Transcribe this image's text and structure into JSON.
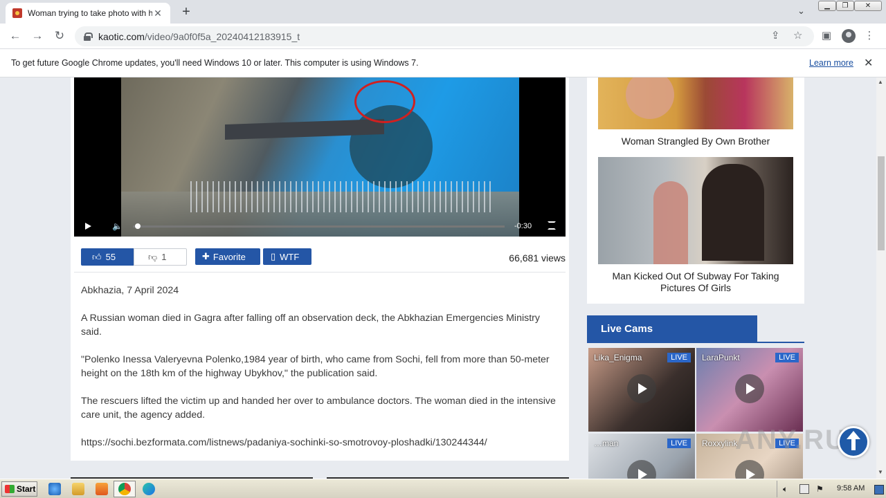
{
  "browser": {
    "tab_title": "Woman trying to take photo with he",
    "tab_close": "✕",
    "new_tab": "+",
    "url_host": "kaotic.com",
    "url_path": "/video/9a0f0f5a_20240412183915_t"
  },
  "infobar": {
    "message": "To get future Google Chrome updates, you'll need Windows 10 or later. This computer is using Windows 7.",
    "learn_more": "Learn more"
  },
  "video": {
    "time": "-0:30"
  },
  "actions": {
    "likes": "55",
    "dislikes": "1",
    "favorite_label": "Favorite",
    "wtf_label": "WTF",
    "views": "66,681 views"
  },
  "article": {
    "dateline": "Abkhazia, 7 April 2024",
    "p1": "A Russian woman died in Gagra after falling off an observation deck, the Abkhazian Emergencies Ministry said.",
    "p2": "\"Polenko Inessa Valeryevna Polenko,1984 year of birth, who came from Sochi, fell from more than 50-meter height on the 18th km of the highway Ubykhov,\" the publication said.",
    "p3": "The rescuers lifted the victim up and handed her over to ambulance doctors. The woman died in the intensive care unit, the agency added.",
    "source": "https://sochi.bezformata.com/listnews/padaniya-sochinki-so-smotrovoy-ploshadki/130244344/"
  },
  "sidebar": {
    "related": [
      {
        "title": "Woman Strangled By Own Brother"
      },
      {
        "title": "Man Kicked Out Of Subway For Taking Pictures Of Girls"
      }
    ],
    "live_cams_title": "Live Cams",
    "cams": [
      {
        "name": "Lika_Enigma",
        "badge": "LIVE"
      },
      {
        "name": "LaraPunkt",
        "badge": "LIVE"
      },
      {
        "name": "…man",
        "badge": "LIVE"
      },
      {
        "name": "Roxxylink",
        "badge": "LIVE"
      }
    ]
  },
  "watermark": "ANY.RUN",
  "taskbar": {
    "start_label": "Start",
    "time": "9:58 AM"
  },
  "colors": {
    "accent": "#2456a6",
    "infobar_link": "#1a4fa0",
    "page_bg": "#e8ebf0"
  }
}
